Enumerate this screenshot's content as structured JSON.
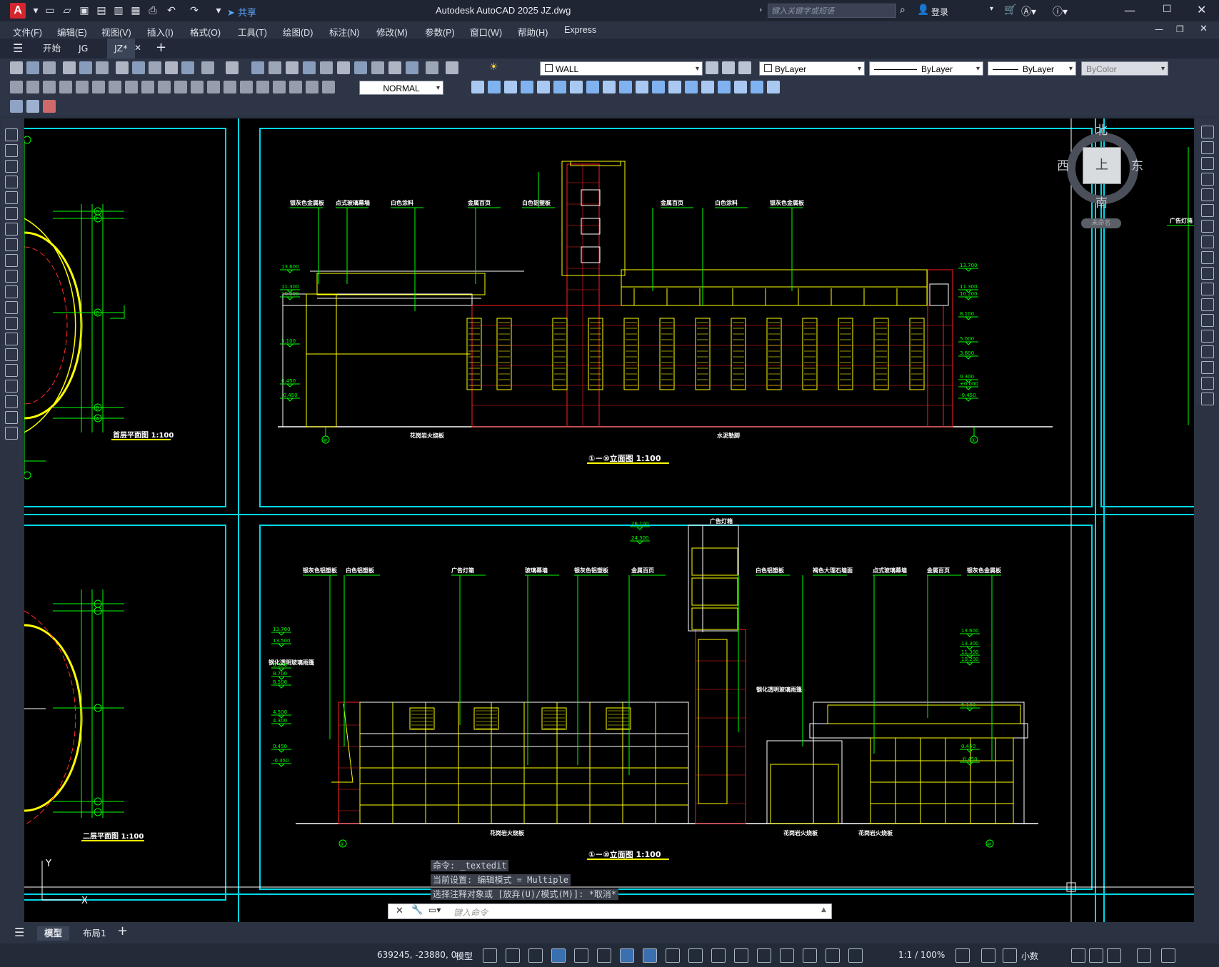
{
  "app": {
    "logo": "A",
    "title": "Autodesk AutoCAD 2025    JZ.dwg",
    "share": "共享",
    "search_placeholder": "键入关键字或短语",
    "login": "登录"
  },
  "menu": [
    "文件(F)",
    "编辑(E)",
    "视图(V)",
    "插入(I)",
    "格式(O)",
    "工具(T)",
    "绘图(D)",
    "标注(N)",
    "修改(M)",
    "参数(P)",
    "窗口(W)",
    "帮助(H)",
    "Express"
  ],
  "tabs": [
    {
      "label": "开始"
    },
    {
      "label": "JG"
    },
    {
      "label": "JZ*",
      "active": true
    }
  ],
  "toolbar": {
    "layer": "WALL",
    "color": "ByLayer",
    "linetype": "ByLayer",
    "lineweight": "ByLayer",
    "plotstyle": "ByColor",
    "dimstyle": "NORMAL"
  },
  "viewcube": {
    "north": "北",
    "south": "南",
    "east": "东",
    "west": "西",
    "top": "上",
    "ucs": "未命名"
  },
  "drawing": {
    "plan1_title": "首层平面图 1:100",
    "plan2_title": "二层平面图 1:100",
    "elev1_title": "①－⑩立面图 1:100",
    "elev2_title": "①－⑩立面图 1:100",
    "elev1_labels": [
      "银灰色金属板",
      "点式玻璃幕墙",
      "白色涂料",
      "金属百页",
      "白色铝塑板",
      "金属百页",
      "白色涂料",
      "银灰色金属板"
    ],
    "elev1_bottom": [
      "花岗岩火烧板",
      "水泥勒脚"
    ],
    "elev2_labels": [
      "银灰色铝塑板",
      "白色铝塑板",
      "广告灯箱",
      "玻璃幕墙",
      "银灰色铝塑板",
      "金属百页",
      "白色铝塑板",
      "褐色大理石墙面",
      "点式玻璃幕墙",
      "金属百页",
      "银灰色金属板"
    ],
    "elev2_top_label": "广告灯箱",
    "elev2_left_label": "钢化透明玻璃雨篷",
    "elev2_mid_label": "钢化透明玻璃雨篷",
    "elev2_bottom": [
      "花岗岩火烧板",
      "花岗岩火烧板",
      "花岗岩火烧板"
    ],
    "side_label": "广告灯箱",
    "axis_1": "①",
    "axis_10": "⑩",
    "grid_labels": [
      "G",
      "F",
      "D",
      "B",
      "A"
    ],
    "levels_left": [
      "13.600",
      "11.300",
      "10.200",
      "5.100",
      "0.450",
      "-0.450"
    ],
    "levels_right": [
      "13.700",
      "11.300",
      "10.200",
      "8.100",
      "5.000",
      "3.600",
      "0.300",
      "±0.000",
      "-0.450"
    ],
    "levels2_left": [
      "13.700",
      "13.500",
      "9.900",
      "8.700",
      "8.500",
      "4.500",
      "4.300",
      "0.450",
      "-0.450"
    ],
    "levels2_top": [
      "26.100",
      "24.300"
    ],
    "levels2_right": [
      "13.600",
      "13.300",
      "11.300",
      "10.200",
      "5.100",
      "0.450",
      "-0.450"
    ]
  },
  "command": {
    "line1": "命令: _textedit",
    "line2": "当前设置: 编辑模式 = Multiple",
    "line3": "选择注释对象或 [放弃(U)/模式(M)]: *取消*",
    "placeholder": "键入命令"
  },
  "layouts": [
    {
      "label": "模型",
      "active": true
    },
    {
      "label": "布局1"
    }
  ],
  "status": {
    "coords": "639245, -23880, 0",
    "model": "模型",
    "scale": "1:1 / 100%",
    "units": "小数"
  }
}
